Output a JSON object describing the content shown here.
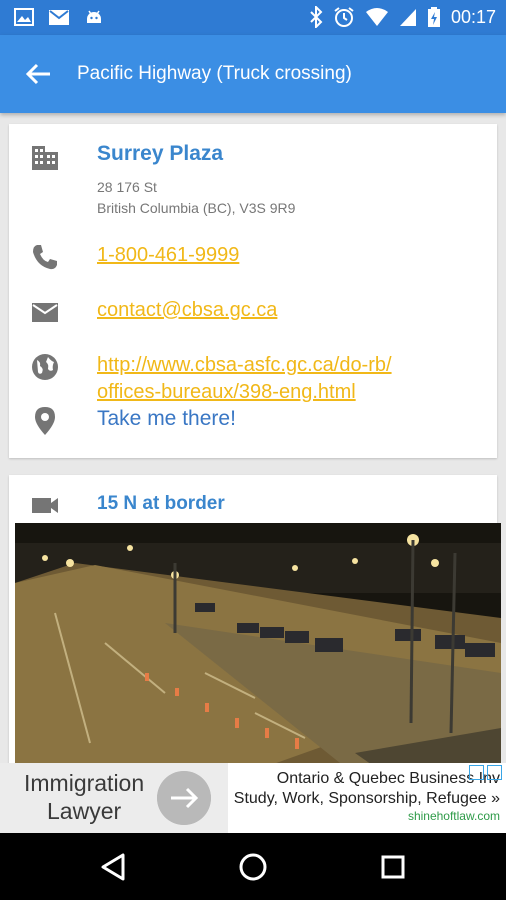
{
  "status_bar": {
    "time": "00:17",
    "left_icons": [
      "image-icon",
      "gmail-icon",
      "android-icon"
    ],
    "right_icons": [
      "bluetooth-icon",
      "alarm-icon",
      "wifi-icon",
      "signal-icon",
      "battery-icon"
    ]
  },
  "app_bar": {
    "title": "Pacific Highway (Truck crossing)",
    "back_icon": "arrow-back-icon"
  },
  "office": {
    "name": "Surrey Plaza",
    "address_line1": "28 176 St",
    "address_line2": "British Columbia (BC), V3S 9R9",
    "phone": "1-800-461-9999",
    "email": "contact@cbsa.gc.ca",
    "website_line1": "http://www.cbsa-asfc.gc.ca/do-rb/",
    "website_line2": "offices-bureaux/398-eng.html",
    "directions": "Take me there!",
    "icons": [
      "building-icon",
      "phone-icon",
      "email-icon",
      "globe-icon",
      "location-pin-icon"
    ]
  },
  "camera": {
    "title": "15 N at border",
    "icon": "videocam-icon"
  },
  "ad": {
    "left_line1": "Immigration",
    "left_line2": "Lawyer",
    "headline_line1": "Ontario & Quebec Business Inv",
    "headline_line2": "Study, Work, Sponsorship, Refugee »",
    "url": "shinehoftlaw.com"
  },
  "nav_bar": {
    "icons": [
      "back-triangle-icon",
      "home-circle-icon",
      "recents-square-icon"
    ]
  },
  "colors": {
    "status_bar": "#2f7bd3",
    "app_bar": "#3b8ee4",
    "accent_blue": "#3a86cd",
    "link_yellow": "#f1b818"
  }
}
